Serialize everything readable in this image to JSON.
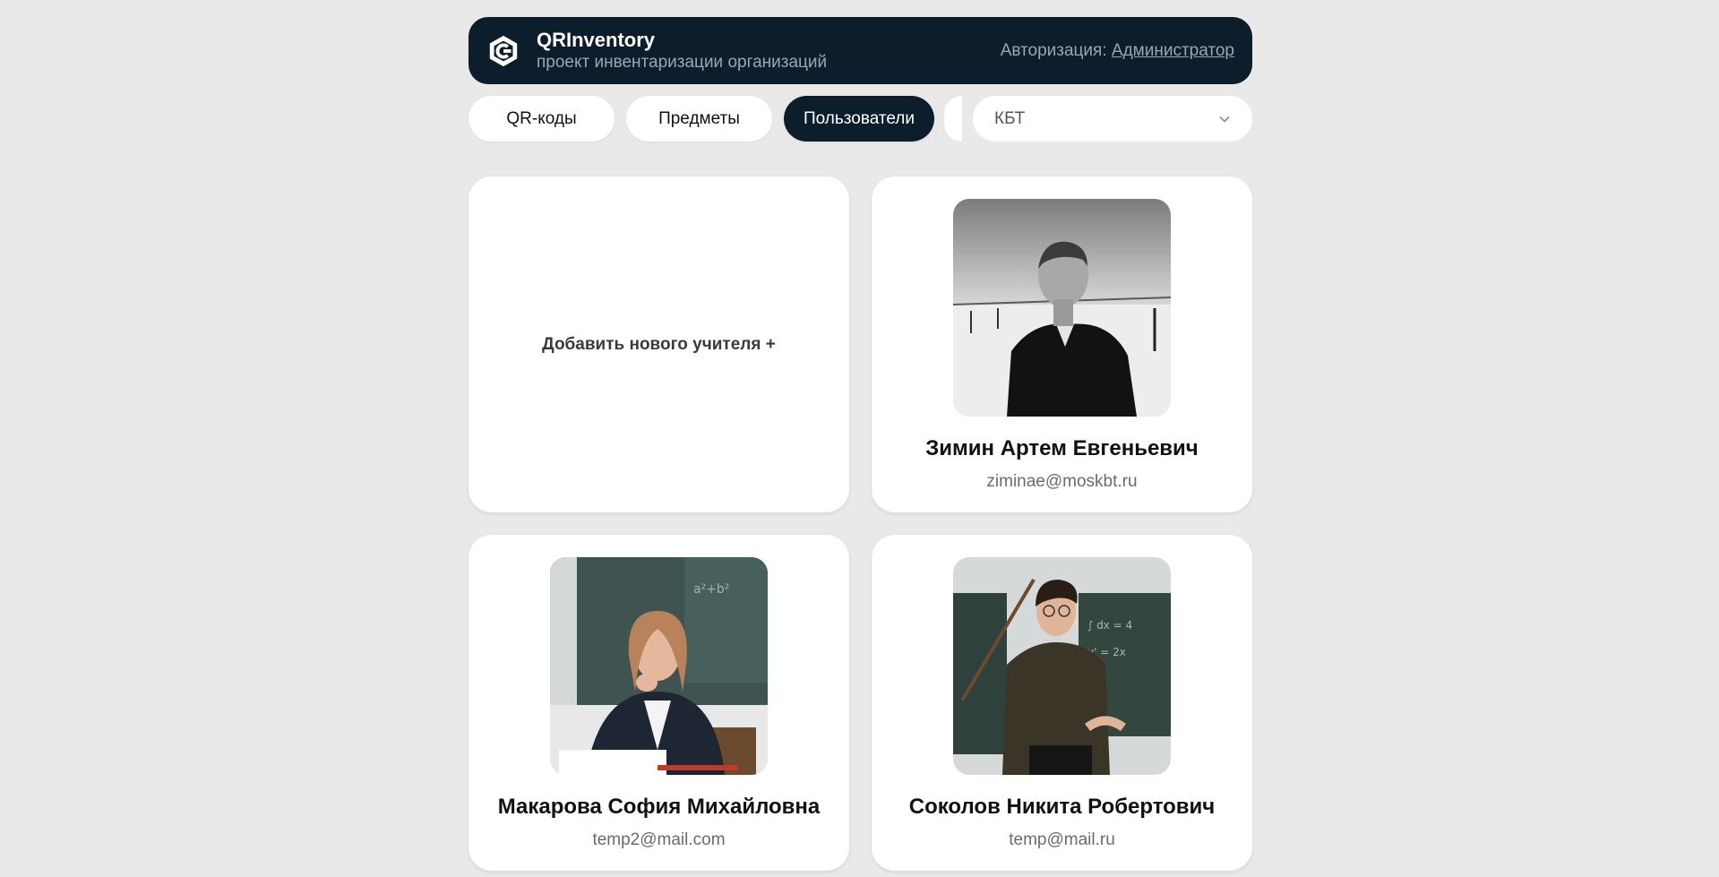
{
  "header": {
    "app_name": "QRInventory",
    "subtitle": "проект инвентаризации организаций",
    "auth_label": "Авторизация:",
    "auth_user": "Администратор",
    "logo_icon": "qrinventory-logo-icon"
  },
  "tabs": [
    {
      "label": "QR-коды",
      "active": false
    },
    {
      "label": "Предметы",
      "active": false
    },
    {
      "label": "Пользователи",
      "active": true
    }
  ],
  "org_select": {
    "value": "КБТ",
    "icon": "chevron-down-icon"
  },
  "add_card": {
    "label": "Добавить нового учителя +"
  },
  "users": [
    {
      "name": "Зимин Артем Евгеньевич",
      "email": "ziminae@moskbt.ru"
    },
    {
      "name": "Макарова София Михайловна",
      "email": "temp2@mail.com"
    },
    {
      "name": "Соколов Никита Робертович",
      "email": "temp@mail.ru"
    }
  ],
  "colors": {
    "background": "#e9e9e9",
    "header": "#0c1e2c",
    "active_tab": "#0c1e2c",
    "card": "#ffffff",
    "muted_text": "#9aa6b2"
  }
}
